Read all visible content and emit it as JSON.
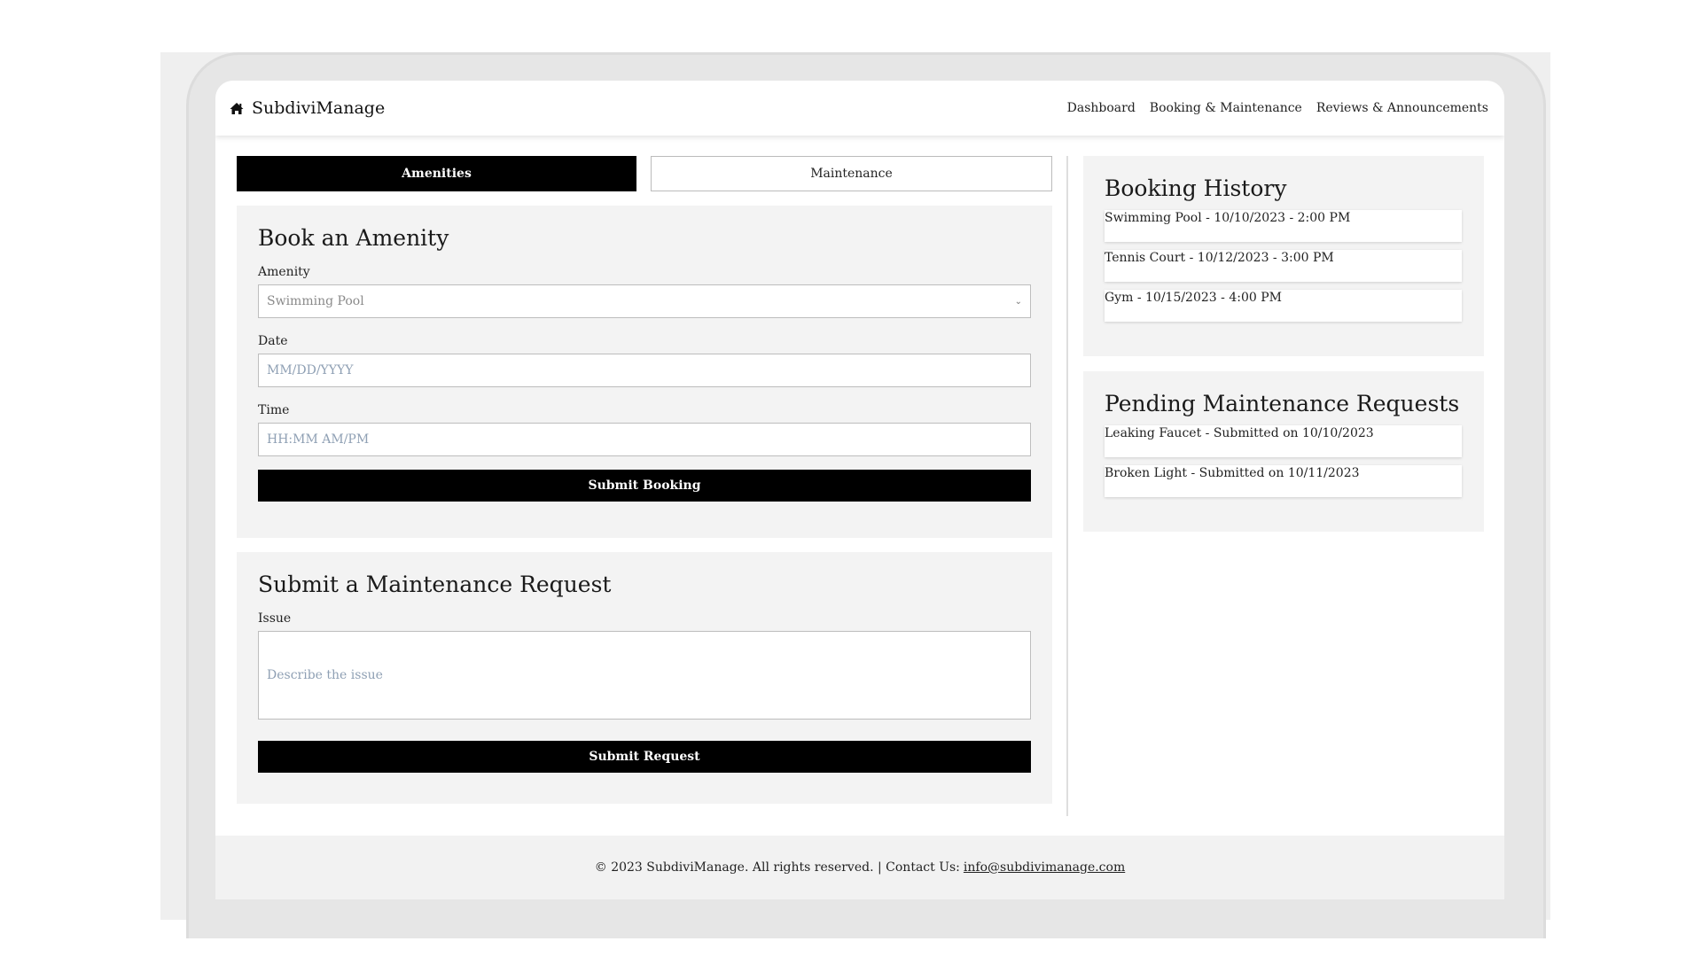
{
  "header": {
    "brand": "SubdiviManage",
    "nav": [
      "Dashboard",
      "Booking & Maintenance",
      "Reviews & Announcements"
    ]
  },
  "tabs": {
    "active": "Amenities",
    "inactive": "Maintenance"
  },
  "booking_form": {
    "title": "Book an Amenity",
    "amenity_label": "Amenity",
    "amenity_value": "Swimming Pool",
    "date_label": "Date",
    "date_placeholder": "MM/DD/YYYY",
    "time_label": "Time",
    "time_placeholder": "HH:MM AM/PM",
    "submit_label": "Submit Booking"
  },
  "maintenance_form": {
    "title": "Submit a Maintenance Request",
    "issue_label": "Issue",
    "issue_placeholder": "Describe the issue",
    "submit_label": "Submit Request"
  },
  "booking_history": {
    "title": "Booking History",
    "items": [
      "Swimming Pool - 10/10/2023 - 2:00 PM",
      "Tennis Court - 10/12/2023 - 3:00 PM",
      "Gym - 10/15/2023 - 4:00 PM"
    ]
  },
  "pending_requests": {
    "title": "Pending Maintenance Requests",
    "items": [
      "Leaking Faucet - Submitted on 10/10/2023",
      "Broken Light - Submitted on 10/11/2023"
    ]
  },
  "footer": {
    "text": "© 2023 SubdiviManage. All rights reserved. | Contact Us:",
    "email": "info@subdivimanage.com"
  },
  "icons": {
    "brand": "home-icon",
    "select": "chevron-down-icon"
  },
  "colors": {
    "primary": "#000000",
    "card_bg": "#f3f3f3"
  }
}
